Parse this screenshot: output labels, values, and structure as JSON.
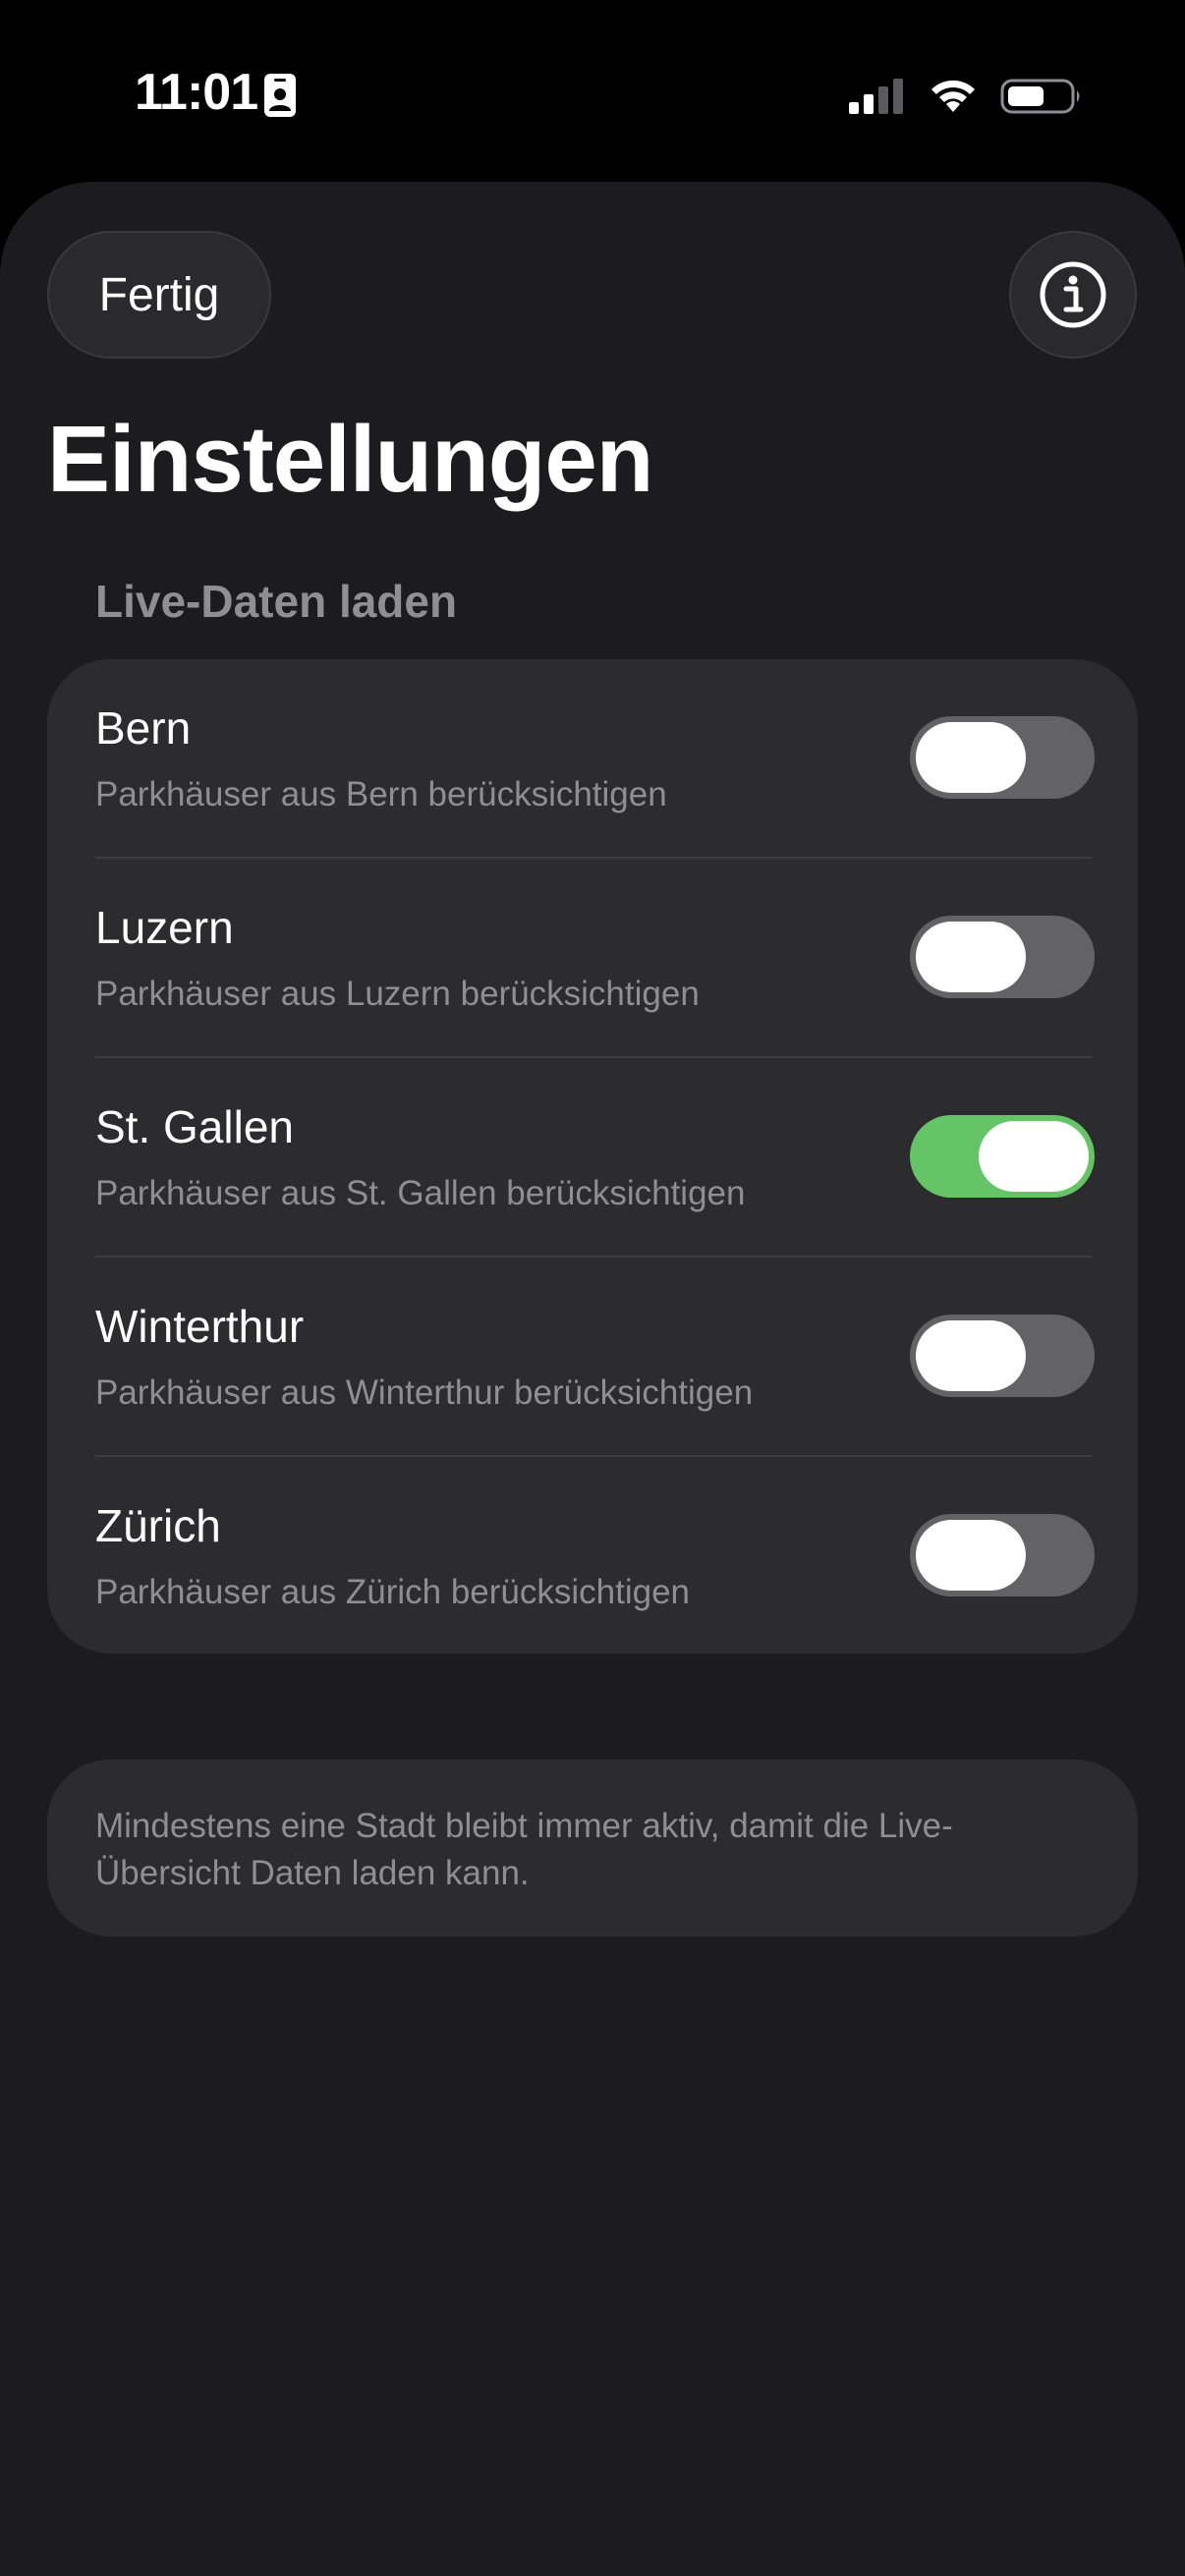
{
  "status_bar": {
    "time": "11:01",
    "icons": [
      "contact-card-icon",
      "cellular-signal-icon",
      "wifi-icon",
      "battery-icon"
    ]
  },
  "header": {
    "done_label": "Fertig",
    "info_icon": "info-icon",
    "title": "Einstellungen"
  },
  "section": {
    "header": "Live-Daten laden",
    "items": [
      {
        "title": "Bern",
        "subtitle": "Parkhäuser aus Bern berücksichtigen",
        "enabled": false
      },
      {
        "title": "Luzern",
        "subtitle": "Parkhäuser aus Luzern berücksichtigen",
        "enabled": false
      },
      {
        "title": "St. Gallen",
        "subtitle": "Parkhäuser aus St. Gallen berücksichtigen",
        "enabled": true
      },
      {
        "title": "Winterthur",
        "subtitle": "Parkhäuser aus Winterthur berücksichtigen",
        "enabled": false
      },
      {
        "title": "Zürich",
        "subtitle": "Parkhäuser aus Zürich berücksichtigen",
        "enabled": false
      }
    ]
  },
  "footnote": {
    "text": "Mindestens eine Stadt bleibt immer aktiv, damit die Live-Übersicht Daten laden kann."
  },
  "colors": {
    "background": "#1c1c1e",
    "card": "#2c2c2e",
    "toggle_on": "#65c466",
    "toggle_off": "#636366",
    "secondary_text": "#8e8e93"
  }
}
